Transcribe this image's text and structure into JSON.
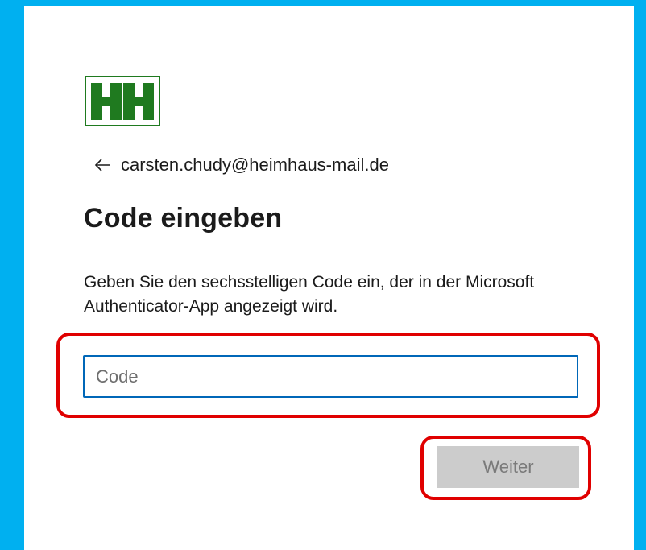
{
  "account": {
    "email": "carsten.chudy@heimhaus-mail.de",
    "back_icon": "arrow-left-icon"
  },
  "logo": {
    "text": "HH",
    "color": "#1f7a1f"
  },
  "page": {
    "title": "Code eingeben",
    "description": "Geben Sie den sechsstelligen Code ein, der in der Microsoft Authenticator-App angezeigt wird."
  },
  "code_field": {
    "value": "",
    "placeholder": "Code"
  },
  "actions": {
    "next_label": "Weiter",
    "next_enabled": false
  },
  "colors": {
    "frame": "#00b0f0",
    "highlight": "#e00000",
    "input_border": "#0067b8",
    "button_disabled_bg": "#cccccc"
  }
}
